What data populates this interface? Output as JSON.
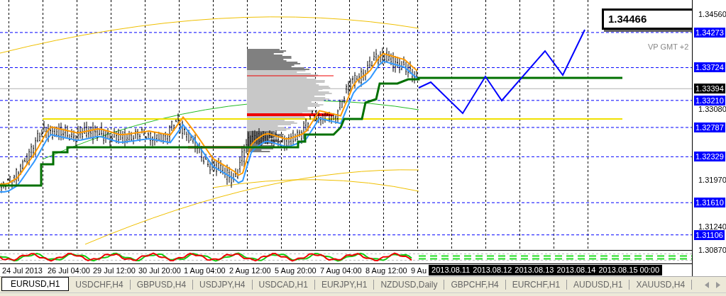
{
  "chart": {
    "price_box": "1.34466",
    "vp_label": "VP GMT +2",
    "price_labels": [
      {
        "text": "1.34560",
        "kind": "tick"
      },
      {
        "text": "1.34273",
        "kind": "level"
      },
      {
        "text": "1.33724",
        "kind": "level"
      },
      {
        "text": "1.33394",
        "kind": "current"
      },
      {
        "text": "1.33210",
        "kind": "level"
      },
      {
        "text": "1.33080",
        "kind": "tick"
      },
      {
        "text": "1.32787",
        "kind": "level"
      },
      {
        "text": "1.32329",
        "kind": "level"
      },
      {
        "text": "1.31970",
        "kind": "tick"
      },
      {
        "text": "1.31610",
        "kind": "level"
      },
      {
        "text": "1.31240",
        "kind": "tick"
      },
      {
        "text": "1.31106",
        "kind": "level"
      },
      {
        "text": "1.30870",
        "kind": "tick"
      }
    ],
    "time_labels": [
      "24 Jul 2013",
      "26 Jul 04:00",
      "29 Jul 12:00",
      "30 Jul 20:00",
      "1 Aug 04:00",
      "2 Aug 12:00",
      "5 Aug 20:00",
      "7 Aug 04:00",
      "8 Aug 12:00",
      "9 Au"
    ],
    "future_time_labels": [
      "2013.08.11",
      "2013.08.12",
      "2013.08.13",
      "2013.08.14",
      "2013.08.15 00:00"
    ]
  },
  "tabs": [
    {
      "label": "EURUSD,H1",
      "selected": true
    },
    {
      "label": "USDCHF,H4",
      "selected": false
    },
    {
      "label": "GBPUSD,H4",
      "selected": false
    },
    {
      "label": "USDJPY,H4",
      "selected": false
    },
    {
      "label": "USDCAD,H1",
      "selected": false
    },
    {
      "label": "EURJPY,H1",
      "selected": false
    },
    {
      "label": "NZDUSD,Daily",
      "selected": false
    },
    {
      "label": "GBPCHF,H4",
      "selected": false
    },
    {
      "label": "EURCHF,H1",
      "selected": false
    },
    {
      "label": "AUDUSD,H1",
      "selected": false
    },
    {
      "label": "XAUUSD,H4",
      "selected": false
    }
  ]
}
